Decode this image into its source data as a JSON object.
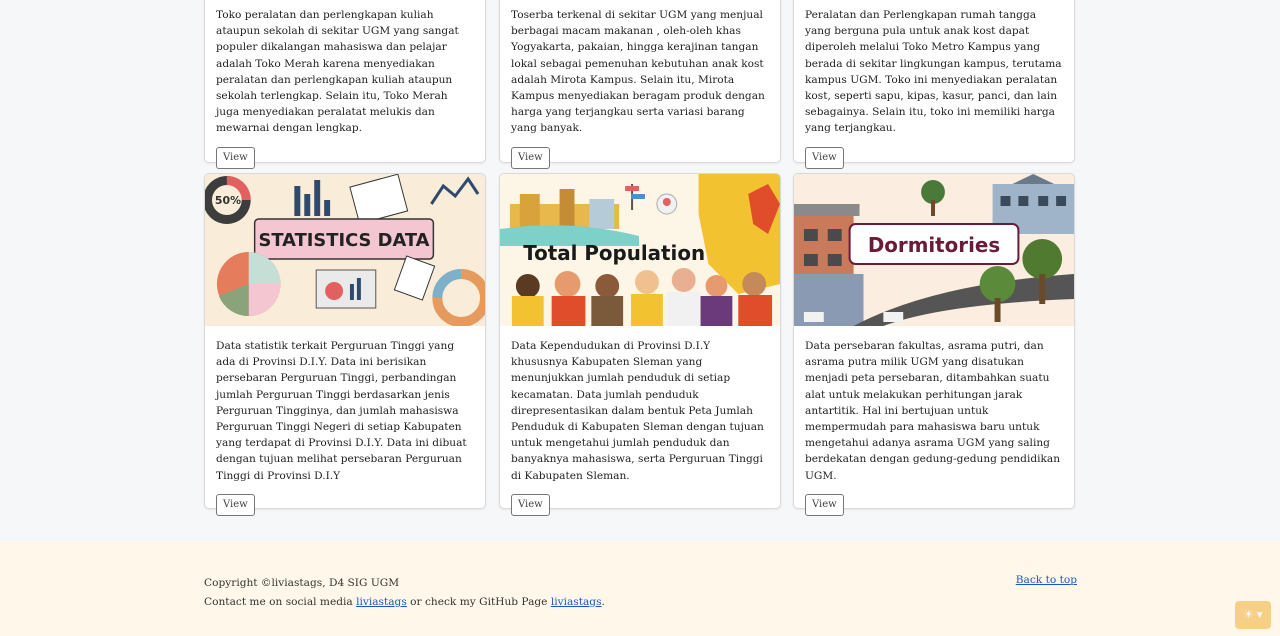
{
  "cards_top": [
    {
      "desc": "Toko peralatan dan perlengkapan kuliah ataupun sekolah di sekitar UGM yang sangat populer dikalangan mahasiswa dan pelajar adalah Toko Merah karena menyediakan peralatan dan perlengkapan kuliah ataupun sekolah terlengkap. Selain itu, Toko Merah juga menyediakan peralatat melukis dan mewarnai dengan lengkap.",
      "button": "View"
    },
    {
      "desc": "Toserba terkenal di sekitar UGM yang menjual berbagai macam makanan , oleh-oleh khas Yogyakarta, pakaian, hingga kerajinan tangan lokal sebagai pemenuhan kebutuhan anak kost adalah Mirota Kampus. Selain itu, Mirota Kampus menyediakan beragam produk dengan harga yang terjangkau serta variasi barang yang banyak.",
      "button": "View"
    },
    {
      "desc": "Peralatan dan Perlengkapan rumah tangga yang berguna pula untuk anak kost dapat diperoleh melalui Toko Metro Kampus yang berada di sekitar lingkungan kampus, terutama kampus UGM. Toko ini menyediakan peralatan kost, seperti sapu, kipas, kasur, panci, dan lain sebagainya. Selain itu, toko ini memiliki harga yang terjangkau.",
      "button": "View"
    }
  ],
  "cards_bottom": [
    {
      "banner": "STATISTICS DATA",
      "badge": "50%",
      "desc": "Data statistik terkait Perguruan Tinggi yang ada di Provinsi D.I.Y. Data ini berisikan persebaran Perguruan Tinggi, perbandingan jumlah Perguruan Tinggi berdasarkan jenis Perguruan Tingginya, dan jumlah mahasiswa Perguruan Tinggi Negeri di setiap Kabupaten yang terdapat di Provinsi D.I.Y. Data ini dibuat dengan tujuan melihat persebaran Perguruan Tinggi di Provinsi D.I.Y",
      "button": "View"
    },
    {
      "banner": "Total Population",
      "desc": "Data Kependudukan di Provinsi D.I.Y khususnya Kabupaten Sleman yang menunjukkan jumlah penduduk di setiap kecamatan. Data jumlah penduduk direpresentasikan dalam bentuk Peta Jumlah Penduduk di Kabupaten Sleman dengan tujuan untuk mengetahui jumlah penduduk dan banyaknya mahasiswa, serta Perguruan Tinggi di Kabupaten Sleman.",
      "button": "View"
    },
    {
      "banner": "Dormitories",
      "desc": "Data persebaran fakultas, asrama putri, dan asrama putra milik UGM yang disatukan menjadi peta persebaran, ditambahkan suatu alat untuk melakukan perhitungan jarak antartitik. Hal ini bertujuan untuk mempermudah para mahasiswa baru untuk mengetahui adanya asrama UGM yang saling berdekatan dengan gedung-gedung pendidikan UGM.",
      "button": "View"
    }
  ],
  "footer": {
    "copyright": "Copyright ©liviastags, D4 SIG UGM",
    "contact_prefix": "Contact me on social media ",
    "contact_link": "liviastags",
    "contact_mid": " or check my GitHub Page ",
    "github_link": "liviastags",
    "contact_suffix": ".",
    "back_to_top": "Back to top"
  },
  "theme_toggle": "☀ ▾"
}
